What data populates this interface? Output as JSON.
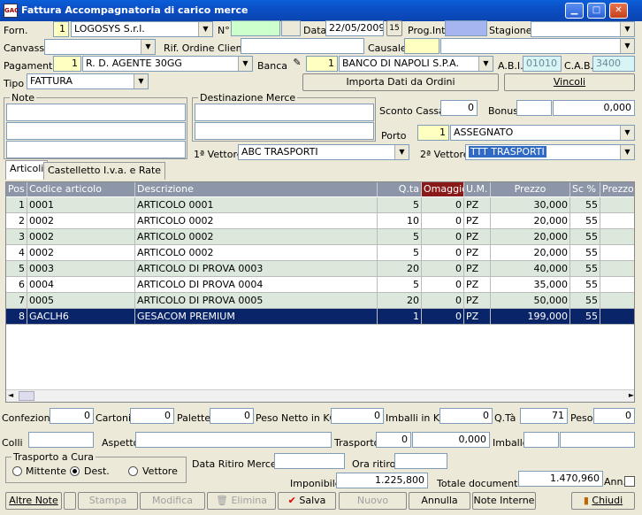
{
  "window": {
    "title": "Fattura Accompagnatoria di carico merce",
    "app_icon": "GAC"
  },
  "header": {
    "forn_label": "Forn.",
    "forn_code": "1",
    "forn_name": "LOGOSYS S.r.l.",
    "num_label": "N°",
    "num_value": "",
    "data_label": "Data",
    "data_value": "22/05/2009",
    "calendar_icon_text": "15",
    "prog_label": "Prog.Int.",
    "prog_value": "",
    "stagione_label": "Stagione",
    "stagione_value": "",
    "canvass_label": "Canvass",
    "canvass_value": "",
    "rif_label": "Rif. Ordine Cliente",
    "rif_value": "",
    "causale_label": "Causale",
    "causale_code": "",
    "causale_value": "",
    "pagamento_label": "Pagamento",
    "pagamento_code": "1",
    "pagamento_name": "R. D. AGENTE 30GG",
    "banca_label": "Banca",
    "banca_code": "1",
    "banca_name": "BANCO DI NAPOLI S.P.A.",
    "abi_label": "A.B.I.",
    "abi_value": "01010",
    "cab_label": "C.A.B.",
    "cab_value": "3400",
    "tipo_label": "Tipo",
    "tipo_value": "FATTURA",
    "importa_button": "Importa Dati da Ordini",
    "vincoli_button": "Vincoli"
  },
  "note": {
    "label": "Note",
    "lines": [
      "",
      "",
      ""
    ]
  },
  "destinazione": {
    "label": "Destinazione Merce",
    "lines": [
      "",
      ""
    ]
  },
  "sconto": {
    "label": "Sconto Cassa",
    "value": "0",
    "bonus_label": "Bonus",
    "bonus_value": "0,000"
  },
  "porto": {
    "label": "Porto",
    "code": "1",
    "value": "ASSEGNATO"
  },
  "vettore1": {
    "label": "1ª Vettore",
    "value": "ABC TRASPORTI"
  },
  "vettore2": {
    "label": "2ª Vettore",
    "value": "TTT TRASPORTI"
  },
  "tabs": [
    "Articoli",
    "Castelletto I.v.a. e Rate"
  ],
  "grid": {
    "columns": [
      "Pos",
      "Codice articolo",
      "Descrizione",
      "Q.ta",
      "Omaggio",
      "U.M.",
      "Prezzo",
      "Sc %",
      "Prezzo"
    ],
    "rows": [
      [
        "1",
        "0001",
        "ARTICOLO 0001",
        "5",
        "0",
        "PZ",
        "30,000",
        "55"
      ],
      [
        "2",
        "0002",
        "ARTICOLO 0002",
        "10",
        "0",
        "PZ",
        "20,000",
        "55"
      ],
      [
        "3",
        "0002",
        "ARTICOLO 0002",
        "5",
        "0",
        "PZ",
        "20,000",
        "55"
      ],
      [
        "4",
        "0002",
        "ARTICOLO 0002",
        "5",
        "0",
        "PZ",
        "20,000",
        "55"
      ],
      [
        "5",
        "0003",
        "ARTICOLO DI PROVA 0003",
        "20",
        "0",
        "PZ",
        "40,000",
        "55"
      ],
      [
        "6",
        "0004",
        "ARTICOLO DI PROVA 0004",
        "5",
        "0",
        "PZ",
        "35,000",
        "55"
      ],
      [
        "7",
        "0005",
        "ARTICOLO DI PROVA 0005",
        "20",
        "0",
        "PZ",
        "50,000",
        "55"
      ],
      [
        "8",
        "GACLH6",
        "GESACOM PREMIUM",
        "1",
        "0",
        "PZ",
        "199,000",
        "55"
      ]
    ]
  },
  "footer": {
    "confezioni_label": "Confezioni",
    "confezioni": "0",
    "cartoni_label": "Cartoni",
    "cartoni": "0",
    "palette_label": "Palette",
    "palette": "0",
    "peso_netto_label": "Peso Netto in KG",
    "peso_netto": "0",
    "imballi_kg_label": "Imballi in KG",
    "imballi_kg": "0",
    "qta_label": "Q.Tà",
    "qta": "71",
    "peso_label": "Peso",
    "peso": "0",
    "colli_label": "Colli",
    "colli": "",
    "aspetto_label": "Aspetto",
    "aspetto": "",
    "trasporto_label": "Trasporto",
    "trasporto": "0",
    "trasporto_val": "0,000",
    "imballo_label": "Imballo",
    "imballo": "",
    "trasporto_cura_label": "Trasporto a Cura",
    "mittente_label": "Mittente",
    "dest_label": "Dest.",
    "vettore_label": "Vettore",
    "data_ritiro_label": "Data Ritiro Merce",
    "data_ritiro": "",
    "ora_ritiro_label": "Ora ritiro",
    "ora_ritiro": "",
    "imponibile_label": "Imponibile",
    "imponibile": "1.225,800",
    "totale_label": "Totale documento",
    "totale": "1.470,960",
    "ann_label": "Ann."
  },
  "buttons": {
    "altre_note": "Altre Note",
    "stampa": "Stampa",
    "modifica": "Modifica",
    "elimina": "Elimina",
    "salva": "Salva",
    "nuovo": "Nuovo",
    "annulla": "Annulla",
    "note_interne": "Note Interne",
    "chiudi": "Chiudi"
  }
}
